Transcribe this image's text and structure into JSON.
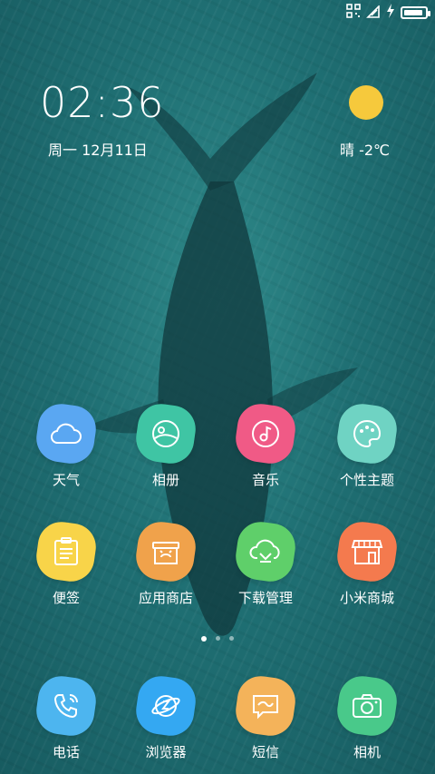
{
  "status": {
    "battery_level": 0.92
  },
  "widget": {
    "time": "02:36",
    "date": "周一 12月11日",
    "weather": "晴 -2℃"
  },
  "apps_row1": [
    {
      "label": "天气",
      "color": "#5aa7f2",
      "icon": "cloud-icon"
    },
    {
      "label": "相册",
      "color": "#3fc5a4",
      "icon": "gallery-icon"
    },
    {
      "label": "音乐",
      "color": "#f05a86",
      "icon": "music-icon"
    },
    {
      "label": "个性主题",
      "color": "#6fd3c3",
      "icon": "palette-icon"
    }
  ],
  "apps_row2": [
    {
      "label": "便签",
      "color": "#f8d449",
      "icon": "notes-icon"
    },
    {
      "label": "应用商店",
      "color": "#f0a24b",
      "icon": "app-store-icon"
    },
    {
      "label": "下载管理",
      "color": "#5fcf6a",
      "icon": "download-icon"
    },
    {
      "label": "小米商城",
      "color": "#f47a4e",
      "icon": "shop-icon"
    }
  ],
  "dock": [
    {
      "label": "电话",
      "color": "#4db5ef",
      "icon": "phone-icon"
    },
    {
      "label": "浏览器",
      "color": "#34a8f2",
      "icon": "browser-icon"
    },
    {
      "label": "短信",
      "color": "#f4b35a",
      "icon": "message-icon"
    },
    {
      "label": "相机",
      "color": "#49c98a",
      "icon": "camera-icon"
    }
  ],
  "pager": {
    "pages": 3,
    "current": 1
  }
}
